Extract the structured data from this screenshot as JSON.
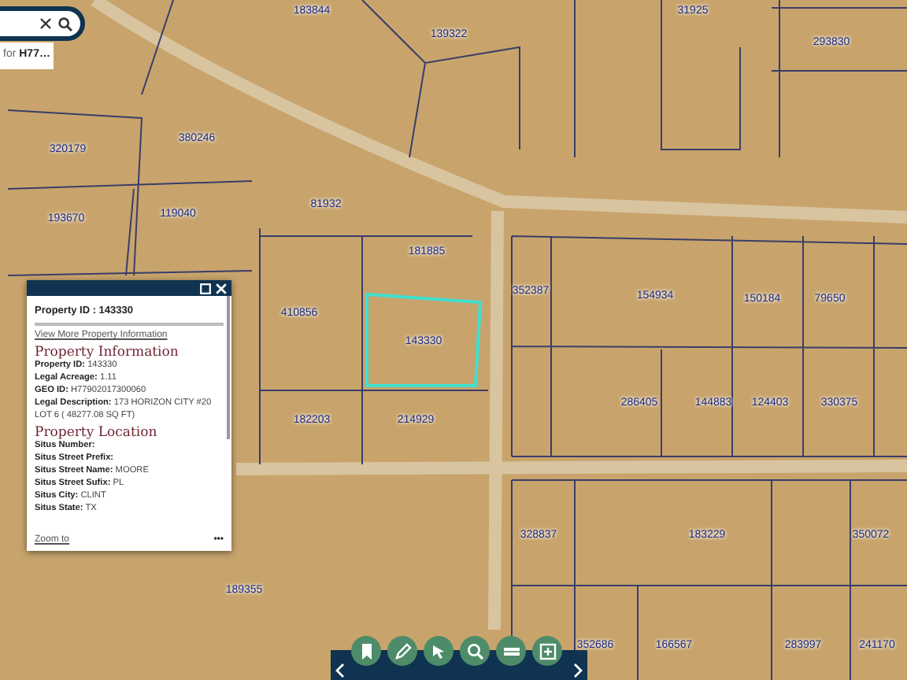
{
  "search": {
    "suggestion": "for **H77…**"
  },
  "map": {
    "parcel_labels": [
      "183844",
      "139322",
      "31925",
      "293830",
      "320179",
      "380246",
      "193670",
      "119040",
      "81932",
      "181885",
      "410856",
      "143330",
      "182203",
      "214929",
      "352387",
      "154934",
      "150184",
      "79650",
      "286405",
      "144883",
      "124403",
      "330375",
      "328837",
      "183229",
      "350072",
      "189355",
      "352686",
      "166567",
      "283997",
      "241170"
    ]
  },
  "popup": {
    "title": "Property ID : 143330",
    "link": "View More Property Information",
    "sections": [
      {
        "heading": "Property Information",
        "fields": [
          {
            "label": "Property ID:",
            "value": "143330"
          },
          {
            "label": "Legal Acreage:",
            "value": "1.11"
          },
          {
            "label": "GEO ID:",
            "value": "H77902017300060"
          },
          {
            "label": "Legal Description:",
            "value": "173 HORIZON CITY #20 LOT 6 ( 48277.08 SQ FT)"
          }
        ]
      },
      {
        "heading": "Property Location",
        "fields": [
          {
            "label": "Situs Number:"
          },
          {
            "label": "Situs Street Prefix:"
          },
          {
            "label": "Situs Street Name:",
            "value": "MOORE"
          },
          {
            "label": "Situs Street Sufix:",
            "value": "PL"
          },
          {
            "label": "Situs City:",
            "value": "CLINT"
          },
          {
            "label": "Situs State:",
            "value": "TX"
          }
        ]
      }
    ],
    "zoom_link": "Zoom to",
    "more": "•••"
  },
  "toolbar": {
    "tools": [
      {
        "kind": "bookmark"
      },
      {
        "kind": "draw"
      },
      {
        "kind": "select"
      },
      {
        "kind": "search"
      },
      {
        "kind": "legend"
      },
      {
        "kind": "add"
      }
    ]
  }
}
